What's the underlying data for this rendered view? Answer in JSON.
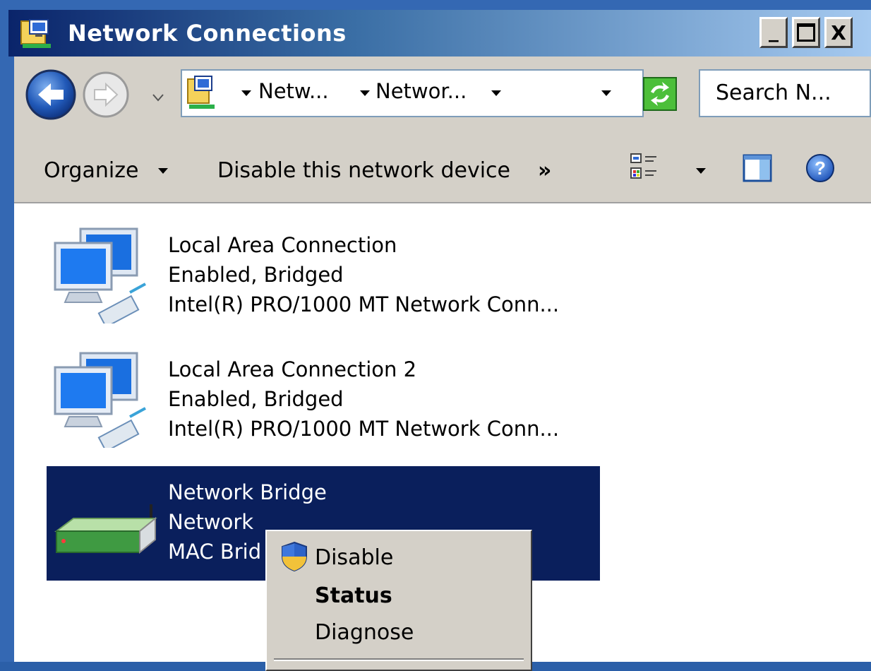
{
  "window": {
    "title": "Network Connections",
    "controls": {
      "minimize": "_",
      "maximize": "□",
      "close": "X"
    }
  },
  "address_bar": {
    "crumbs": [
      "Netw...",
      "Networ..."
    ],
    "search_placeholder": "Search N...",
    "icon": "network-folder-icon"
  },
  "toolbar": {
    "organize_label": "Organize",
    "disable_label": "Disable this network device",
    "more_label": "»"
  },
  "connections": [
    {
      "name": "Local Area Connection",
      "status": "Enabled, Bridged",
      "device": "Intel(R) PRO/1000 MT Network Conn...",
      "icon": "network-computers-icon",
      "selected": false
    },
    {
      "name": "Local Area Connection 2",
      "status": "Enabled, Bridged",
      "device": "Intel(R) PRO/1000 MT Network Conn...",
      "icon": "network-computers-icon",
      "selected": false
    },
    {
      "name": "Network Bridge",
      "status": "Network",
      "device": "MAC Brid",
      "icon": "network-bridge-icon",
      "selected": true
    }
  ],
  "context_menu": {
    "items": [
      {
        "label": "Disable",
        "icon": "uac-shield-icon",
        "bold": false
      },
      {
        "label": "Status",
        "bold": true
      },
      {
        "label": "Diagnose",
        "bold": false
      }
    ]
  },
  "colors": {
    "selection": "#0a1f5c",
    "title_start": "#0a246a",
    "title_end": "#a6caf0",
    "chrome": "#d4d0c8"
  }
}
